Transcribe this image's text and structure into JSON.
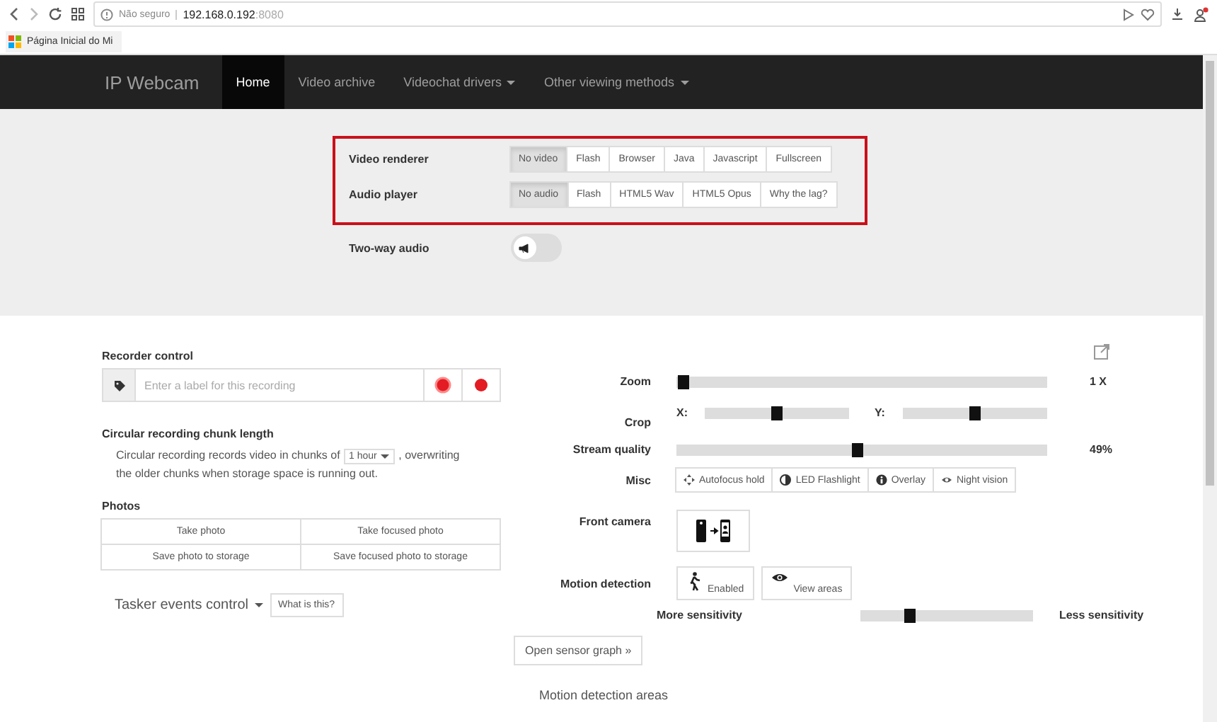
{
  "browser": {
    "security": "Não seguro",
    "host": "192.168.0.192",
    "port": ":8080",
    "bookmark": "Página Inicial do Mi"
  },
  "navbar": {
    "brand": "IP Webcam",
    "items": [
      {
        "label": "Home",
        "selected": true,
        "dropdown": false
      },
      {
        "label": "Video archive",
        "selected": false,
        "dropdown": false
      },
      {
        "label": "Videochat drivers",
        "selected": false,
        "dropdown": true
      },
      {
        "label": "Other viewing methods",
        "selected": false,
        "dropdown": true
      }
    ]
  },
  "player_settings": {
    "rows": [
      {
        "label": "Video renderer",
        "options": [
          {
            "label": "No video",
            "selected": true
          },
          {
            "label": "Flash",
            "selected": false
          },
          {
            "label": "Browser",
            "selected": false
          },
          {
            "label": "Java",
            "selected": false
          },
          {
            "label": "Javascript",
            "selected": false
          },
          {
            "label": "Fullscreen",
            "selected": false
          }
        ]
      },
      {
        "label": "Audio player",
        "options": [
          {
            "label": "No audio",
            "selected": true
          },
          {
            "label": "Flash",
            "selected": false
          },
          {
            "label": "HTML5 Wav",
            "selected": false
          },
          {
            "label": "HTML5 Opus",
            "selected": false
          },
          {
            "label": "Why the lag?",
            "selected": false
          }
        ]
      }
    ],
    "two_way_audio": {
      "label": "Two-way audio",
      "on": false
    }
  },
  "recorder": {
    "title": "Recorder control",
    "placeholder": "Enter a label for this recording"
  },
  "chunk": {
    "title": "Circular recording chunk length",
    "text_before": "Circular recording records video in chunks of",
    "select": "1 hour",
    "text_after": ", overwriting",
    "text_line2": "the older chunks when storage space is running out."
  },
  "photos": {
    "title": "Photos",
    "buttons": [
      "Take photo",
      "Take focused photo",
      "Save photo to storage",
      "Save focused photo to storage"
    ]
  },
  "tasker": {
    "label": "Tasker events control",
    "help": "What is this?"
  },
  "controls": {
    "zoom": {
      "label": "Zoom",
      "level": 0.02,
      "reading": "1 X"
    },
    "crop": {
      "label": "Crop",
      "axes": [
        {
          "label": "X:",
          "level": 0.5
        },
        {
          "label": "Y:",
          "level": 0.5
        }
      ]
    },
    "stream_quality": {
      "label": "Stream quality",
      "level": 0.49,
      "reading": "49%"
    },
    "misc": {
      "label": "Misc",
      "buttons": [
        "Autofocus hold",
        "LED Flashlight",
        "Overlay",
        "Night vision"
      ]
    },
    "front_camera": {
      "label": "Front camera"
    },
    "motion": {
      "label": "Motion detection",
      "buttons": [
        "Enabled",
        "View areas"
      ]
    },
    "sensitivity": {
      "more": "More sensitivity",
      "level": 0.28,
      "less": "Less sensitivity"
    },
    "sensor_graph": "Open sensor graph »",
    "areas_heading": "Motion detection areas"
  }
}
